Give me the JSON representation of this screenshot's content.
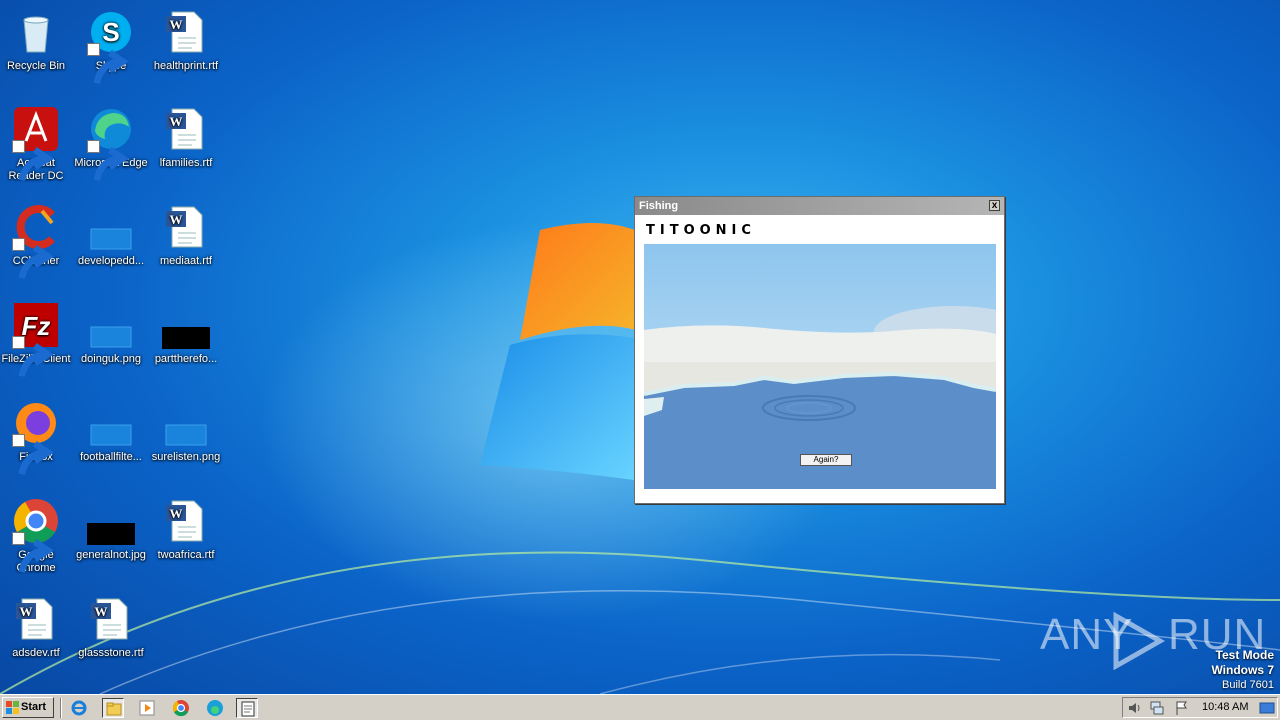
{
  "desktop": {
    "icons": [
      {
        "label": "Recycle Bin",
        "icon": "recycle-bin-icon"
      },
      {
        "label": "Skype",
        "icon": "skype-icon"
      },
      {
        "label": "healthprint.rtf",
        "icon": "word-document-icon"
      },
      {
        "label": "Acrobat Reader DC",
        "icon": "acrobat-reader-icon"
      },
      {
        "label": "Microsoft Edge",
        "icon": "edge-icon"
      },
      {
        "label": "lfamilies.rtf",
        "icon": "word-document-icon"
      },
      {
        "label": "CCleaner",
        "icon": "ccleaner-icon"
      },
      {
        "label": "developedd...",
        "icon": "image-file-icon"
      },
      {
        "label": "mediaat.rtf",
        "icon": "word-document-icon"
      },
      {
        "label": "FileZilla Client",
        "icon": "filezilla-icon"
      },
      {
        "label": "doinguk.png",
        "icon": "image-file-icon"
      },
      {
        "label": "parttherefo...",
        "icon": "image-file-icon"
      },
      {
        "label": "Firefox",
        "icon": "firefox-icon"
      },
      {
        "label": "footballfilte...",
        "icon": "image-file-icon"
      },
      {
        "label": "surelisten.png",
        "icon": "image-file-icon"
      },
      {
        "label": "Google Chrome",
        "icon": "chrome-icon"
      },
      {
        "label": "generalnot.jpg",
        "icon": "image-file-icon"
      },
      {
        "label": "twoafrica.rtf",
        "icon": "word-document-icon"
      },
      {
        "label": "adsdev.rtf",
        "icon": "word-document-icon"
      },
      {
        "label": "glassstone.rtf",
        "icon": "word-document-icon"
      }
    ]
  },
  "window": {
    "title": "Fishing",
    "close_label": "x",
    "brand": "TITOONIC",
    "again_label": "Again?"
  },
  "taskbar": {
    "start_label": "Start",
    "pinned": [
      "ie-icon",
      "explorer-icon",
      "media-player-icon",
      "chrome-icon",
      "edge-icon",
      "notepad-icon"
    ],
    "clock": "10:48 AM"
  },
  "tray": {
    "icons": [
      "volume-icon",
      "network-icon",
      "action-center-flag-icon",
      "show-desktop-icon"
    ]
  },
  "watermark": {
    "left": "ANY",
    "right": "RUN"
  },
  "os_info": {
    "line1": "Test Mode",
    "line2": "Windows 7",
    "line3": "Build 7601"
  }
}
